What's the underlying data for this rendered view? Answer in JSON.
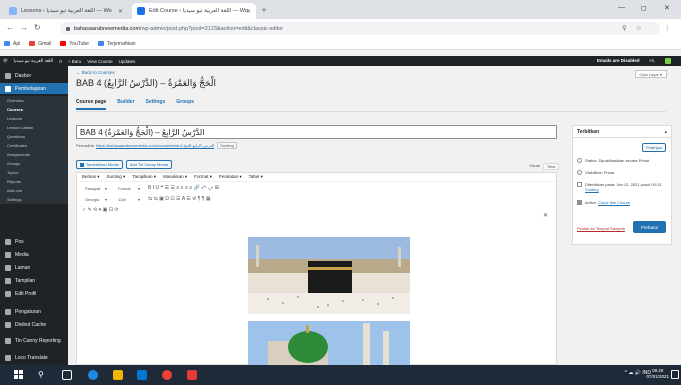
{
  "browser": {
    "tabs": [
      {
        "label": "Lessons ‹ اللغة العربية تيو سيديا — Wo",
        "active": false
      },
      {
        "label": "Edit Course ‹ اللغة العربية تيو سيديا — Wo",
        "active": true
      }
    ],
    "new_tab": "+",
    "window_controls": [
      "—",
      "◻",
      "✕"
    ],
    "url_host": "bahasaarabnewmedia.com",
    "url_path": "/wp-admin/post.php?post=2123&action=edit&classic-editor",
    "bookmarks": [
      {
        "label": "Apl",
        "color": "#4285f4"
      },
      {
        "label": "Gmail",
        "color": "#ea4335"
      },
      {
        "label": "YouTube",
        "color": "#ff0000"
      },
      {
        "label": "Terjemahkan",
        "color": "#4285f4"
      }
    ]
  },
  "adminbar": {
    "items": [
      "اللغة العربية تيو سيديا",
      "0",
      "+ Baru",
      "View Course",
      "Updates"
    ],
    "warning": "Emails are Disabled",
    "greeting": "Hi, "
  },
  "sidebar": {
    "items": [
      {
        "label": "Dasbor",
        "active": false
      },
      {
        "label": "Pembelajaran",
        "active": true
      }
    ],
    "submenu": [
      "Overview",
      "Courses",
      "Lessons",
      "Lesson Lathan",
      "Questions",
      "Certificates",
      "Assignments",
      "Groups",
      "Topics",
      "Reports",
      "Add-ons",
      "Settings"
    ],
    "submenu_current": "Courses",
    "lower_items": [
      "Pos",
      "Media",
      "Laman",
      "Tampilan",
      "Edit Profil",
      "Pengaturan",
      "Divibot Cache",
      "Tin Canny Reporting",
      "Loco Translate"
    ]
  },
  "page": {
    "back_link": "← Back to Courses",
    "title": "BAB 4 (الْحَجُّ وَالعَمْرَةُ – (الدَّرْسُ الرَّابِعُ",
    "screen_options": "Opsi Layar ▾",
    "subtabs": [
      "Course page",
      "Builder",
      "Settings",
      "Groups"
    ],
    "title_value": "BAB 4 (الدَّرْسُ الرَّابِعُ – (الْحَجُّ وَالعَمْرَةُ",
    "permalink_label": "Permalink:",
    "permalink_url": "https://bahasaarabnewmedia.com/courses/bab-4-الدرس-الرابع-الحج",
    "permalink_edit": "Sunting",
    "add_media": "Tambahkan Media",
    "add_tincanny": "Add Tin Canny Media",
    "tab_visual": "Visual",
    "tab_text": "Teks"
  },
  "editor": {
    "menu": [
      "Berkas ▾",
      "Sunting ▾",
      "Tampilkan ▾",
      "Masukkan ▾",
      "Format ▾",
      "Peralatan ▾",
      "Tabel ▾"
    ],
    "paragraph": "Paragraf",
    "format": "Format",
    "font": "Georgia",
    "size": "12pt",
    "row1_icons": "B   I   U   ❝   ☰   ☰   ≡   ≡   ≡   ≡   🔗   ⤺   ⤻   ⊞",
    "row2_icons": "⇆   ⇆   ▣   Ω   ⊡   ☰   A   ☰   ⊘   ¶   ¶   ▦",
    "row3_icons": "✓   ✎   ⟲   ▾   ▣   ⊡   ⟳",
    "close": "✕"
  },
  "publish": {
    "heading": "Terbitkan",
    "collapse": "▴",
    "preview": "Pratinjau",
    "status": "Status: Dipublikasikan secara Privat",
    "visibility": "Visibilitas: Privat",
    "published_on": "Diterbitkan pada: Jan 12, 2021 pukul 09:13",
    "published_edit": "Sunting",
    "active": "Active:",
    "active_link": "Clone this Course",
    "trash": "Pindah ke Tempat Sampah",
    "update": "Perbarui"
  },
  "taskbar": {
    "tray": "^ ☁ 🔊 IND",
    "time": "08.28",
    "date": "07/01/2021"
  }
}
